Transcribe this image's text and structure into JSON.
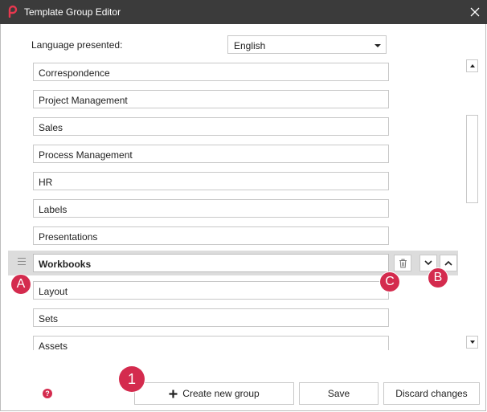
{
  "window": {
    "title": "Template Group Editor"
  },
  "language": {
    "label": "Language presented:",
    "selected": "English"
  },
  "groups": [
    "Correspondence",
    "Project Management",
    "Sales",
    "Process Management",
    "HR",
    "Labels",
    "Presentations",
    "Workbooks",
    "Layout",
    "Sets",
    "Assets"
  ],
  "markers": {
    "a": "A",
    "b": "B",
    "c": "C",
    "one": "1"
  },
  "buttons": {
    "create": "Create new group",
    "save": "Save",
    "discard": "Discard changes"
  },
  "help": "?",
  "colors": {
    "titlebar": "#3b3b3b",
    "accent": "#d42b4e",
    "selected_row": "#dcdcdc"
  }
}
